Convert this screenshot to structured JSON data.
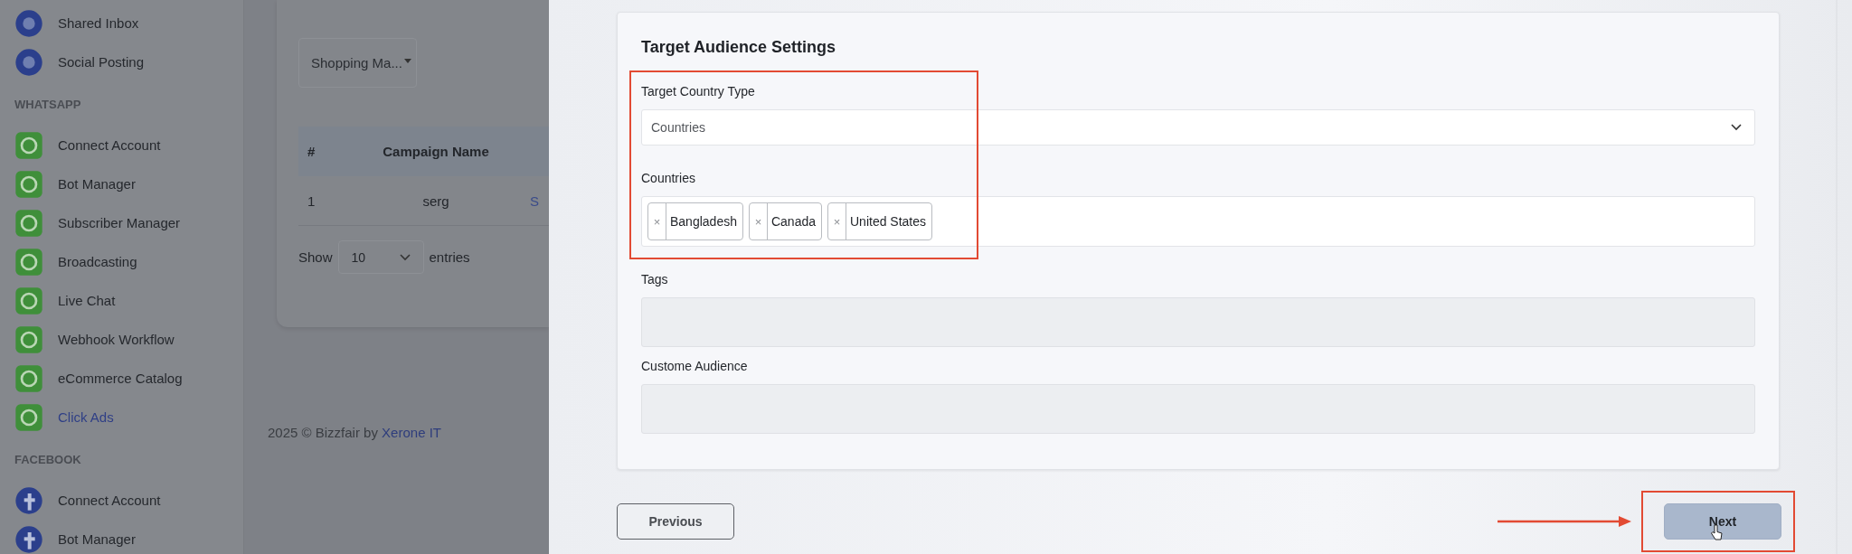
{
  "sidebar": {
    "sections": [
      {
        "items": [
          {
            "label": "Shared Inbox",
            "selected": false
          },
          {
            "label": "Social Posting",
            "selected": false
          }
        ]
      },
      {
        "heading": "WHATSAPP",
        "items": [
          {
            "label": "Connect Account",
            "selected": false
          },
          {
            "label": "Bot Manager",
            "selected": false
          },
          {
            "label": "Subscriber Manager",
            "selected": false
          },
          {
            "label": "Broadcasting",
            "selected": false
          },
          {
            "label": "Live Chat",
            "selected": false
          },
          {
            "label": "Webhook Workflow",
            "selected": false
          },
          {
            "label": "eCommerce Catalog",
            "selected": false
          },
          {
            "label": "Click Ads",
            "selected": true
          }
        ]
      },
      {
        "heading": "FACEBOOK",
        "items": [
          {
            "label": "Connect Account",
            "selected": false
          },
          {
            "label": "Bot Manager",
            "selected": false
          }
        ]
      }
    ]
  },
  "background_page": {
    "filter": {
      "value": "Shopping Ma..."
    },
    "table": {
      "columns": [
        "#",
        "Campaign Name"
      ],
      "rows": [
        {
          "cells": [
            "1",
            "serg",
            "S"
          ]
        }
      ]
    },
    "page_length": {
      "before": "Show",
      "value": "10",
      "after": "entries"
    },
    "footer": {
      "text": "2025 © Bizzfair by ",
      "link": "Xerone IT"
    }
  },
  "modal": {
    "title": "Target Audience Settings",
    "fields": [
      {
        "kind": "select",
        "label": "Target Country Type",
        "value": "Countries"
      },
      {
        "kind": "tags",
        "label": "Countries",
        "tags": [
          {
            "remove": "×",
            "label": "Bangladesh"
          },
          {
            "remove": "×",
            "label": "Canada"
          },
          {
            "remove": "×",
            "label": "United States"
          }
        ]
      },
      {
        "kind": "input",
        "label": "Tags"
      },
      {
        "kind": "input",
        "label": "Custome Audience"
      }
    ],
    "buttons": [
      {
        "kind": "secondary",
        "label": "Previous"
      },
      {
        "kind": "primary",
        "label": "Next"
      }
    ]
  }
}
